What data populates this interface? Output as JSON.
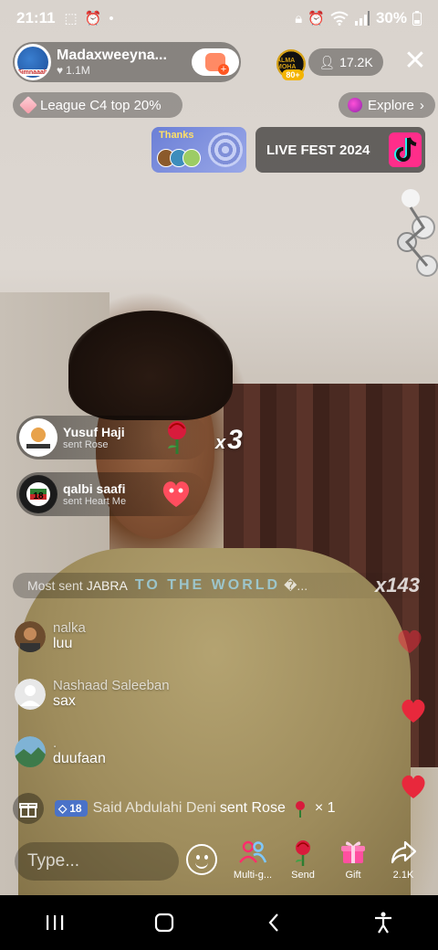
{
  "status": {
    "time": "21:11",
    "battery": "30%"
  },
  "host": {
    "name": "Madaxweeyna...",
    "likes": "1.1M",
    "avatar_tag": "5imnaaab"
  },
  "top_viewer": {
    "badge": "80+",
    "label": "ALMA MOHA"
  },
  "viewers": "17.2K",
  "league": "League C4 top 20%",
  "explore": "Explore",
  "banners": {
    "thanks": "Thanks",
    "live_fest": "LIVE FEST 2024"
  },
  "gift_notifications": [
    {
      "user": "Yusuf Haji",
      "action": "sent Rose",
      "gift": "rose-icon"
    },
    {
      "user": "qalbi saafi",
      "action": "sent Heart Me",
      "gift": "heart-me-icon"
    }
  ],
  "combo": {
    "prefix": "x",
    "count": "3"
  },
  "most_sent": {
    "label": "Most sent",
    "user": "JABRA",
    "gift": "TO THE WORLD",
    "suffix": "�...",
    "count": "x143"
  },
  "comments": [
    {
      "user": "nalka",
      "message": "luu"
    },
    {
      "user": "Nashaad Saleeban",
      "message": "sax"
    },
    {
      "user": ".",
      "message": "duufaan"
    }
  ],
  "join_row": {
    "level": "18",
    "user": "Said Abdulahi Deni",
    "action": "sent Rose",
    "count": "× 1"
  },
  "input": {
    "placeholder": "Type..."
  },
  "actions": [
    {
      "label": "Multi-g...",
      "icon": "multi-guest-icon"
    },
    {
      "label": "Send",
      "icon": "rose-icon"
    },
    {
      "label": "Gift",
      "icon": "gift-icon"
    },
    {
      "label": "2.1K",
      "icon": "share-icon"
    }
  ],
  "colors": {
    "accent_pink": "#ff2d6b",
    "heart_red": "#e8283c",
    "level_blue": "#4a72c8"
  }
}
